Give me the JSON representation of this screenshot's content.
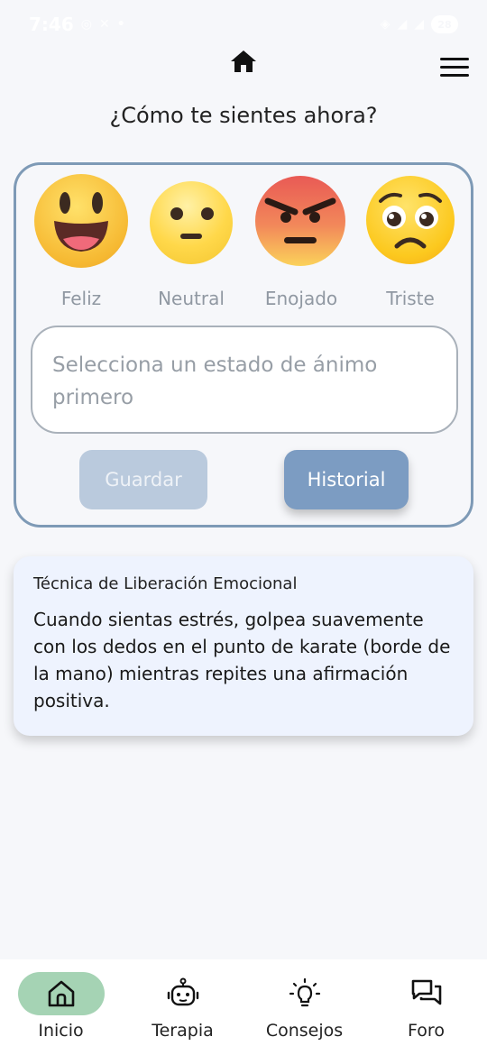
{
  "status_bar": {
    "time": "7:46",
    "battery": "28"
  },
  "header": {
    "home_icon": "home-icon",
    "menu_icon": "menu-icon"
  },
  "page_title": "¿Cómo te sientes ahora?",
  "moods": [
    {
      "label": "Feliz",
      "icon": "happy-emoji-icon"
    },
    {
      "label": "Neutral",
      "icon": "neutral-emoji-icon"
    },
    {
      "label": "Enojado",
      "icon": "angry-emoji-icon"
    },
    {
      "label": "Triste",
      "icon": "sad-emoji-icon"
    }
  ],
  "note_input": {
    "placeholder": "Selecciona un estado de ánimo primero"
  },
  "buttons": {
    "save": "Guardar",
    "history": "Historial"
  },
  "tip": {
    "title": "Técnica de Liberación Emocional",
    "body": "Cuando sientas estrés, golpea suavemente con los dedos en el punto de karate (borde de la mano) mientras repites una afirmación positiva."
  },
  "nav": [
    {
      "label": "Inicio",
      "icon": "home-outline-icon",
      "active": true
    },
    {
      "label": "Terapia",
      "icon": "robot-icon",
      "active": false
    },
    {
      "label": "Consejos",
      "icon": "lightbulb-icon",
      "active": false
    },
    {
      "label": "Foro",
      "icon": "forum-icon",
      "active": false
    }
  ],
  "colors": {
    "card_border": "#7e9ab6",
    "history_button": "#7c9cc2",
    "save_button_disabled": "#bacadd",
    "nav_active_pill": "#a5d3b4",
    "tip_background": "#eef3fe"
  }
}
